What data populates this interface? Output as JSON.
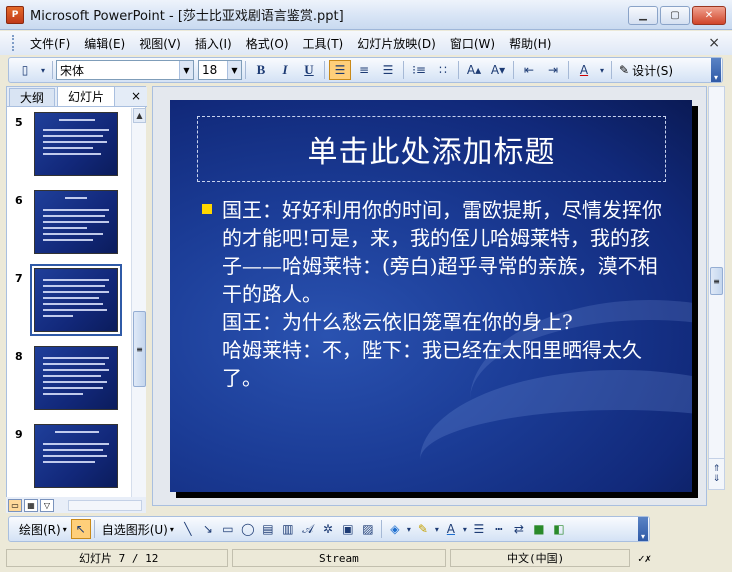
{
  "window": {
    "app_icon_text": "P",
    "title": "Microsoft PowerPoint - [莎士比亚戏剧语言鉴赏.ppt]",
    "minimize": "▁",
    "maximize": "▢",
    "close": "✕"
  },
  "menu": {
    "items": [
      "文件(F)",
      "编辑(E)",
      "视图(V)",
      "插入(I)",
      "格式(O)",
      "工具(T)",
      "幻灯片放映(D)",
      "窗口(W)",
      "帮助(H)"
    ],
    "close_doc": "×"
  },
  "toolbar": {
    "font_name": "宋体",
    "font_size": "18",
    "bold": "B",
    "italic": "I",
    "underline": "U",
    "design_label": "设计(S)"
  },
  "outline_tabs": {
    "outline": "大纲",
    "slides": "幻灯片",
    "close": "×"
  },
  "thumbnails": [
    {
      "number": "5"
    },
    {
      "number": "6"
    },
    {
      "number": "7",
      "selected": true
    },
    {
      "number": "8"
    },
    {
      "number": "9"
    }
  ],
  "slide": {
    "title_placeholder": "单击此处添加标题",
    "body_lines": "国王：好好利用你的时间，雷欧提斯，尽情发挥你的才能吧!可是，来，我的侄儿哈姆莱特，我的孩子——哈姆莱特：(旁白)超乎寻常的亲族，漠不相干的路人。\n国王：为什么愁云依旧笼罩在你的身上?\n哈姆莱特：不，陛下：我已经在太阳里晒得太久了。",
    "bullet_color": "#ffd700"
  },
  "drawing_toolbar": {
    "draw_label": "绘图(R)",
    "autoshapes_label": "自选图形(U)"
  },
  "status": {
    "slide_index": "幻灯片 7 / 12",
    "design": "Stream",
    "language": "中文(中国)"
  }
}
